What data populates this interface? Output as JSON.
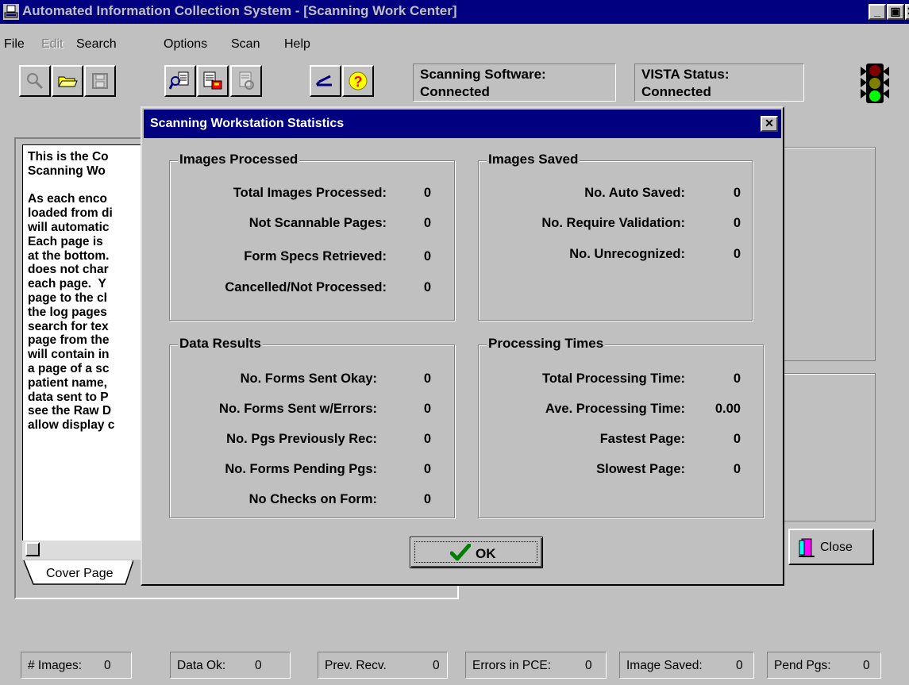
{
  "window": {
    "title": "Automated Information Collection System - [Scanning Work Center]",
    "min_glyph": "_",
    "restore_glyph": "▣",
    "close_glyph": "✕"
  },
  "menu": [
    {
      "label": "File",
      "disabled": false
    },
    {
      "label": "Edit",
      "disabled": true
    },
    {
      "label": "Search",
      "disabled": false
    },
    {
      "label": "Options",
      "disabled": false
    },
    {
      "label": "Scan",
      "disabled": false
    },
    {
      "label": "Help",
      "disabled": false
    }
  ],
  "toolbar": {
    "buttons": [
      "search-icon",
      "open-folder-icon",
      "save-disk-icon",
      "scan-document-icon",
      "edit-document-icon",
      "document-disabled-icon",
      "scanner-icon",
      "help-icon"
    ]
  },
  "status": {
    "scanning_label": "Scanning Software:",
    "scanning_value": "Connected",
    "vista_label": "VISTA Status:",
    "vista_value": "Connected",
    "traffic_light": "traffic-light-icon",
    "colors": {
      "red": "#800000",
      "yellow": "#808000",
      "green": "#00ff00"
    }
  },
  "cover": {
    "text": "This is the Co\nScanning Wo\n\nAs each enco\nloaded from di\nwill automatic\nEach page is\nat the bottom.\ndoes not char\neach page.  Y\npage to the cl\nthe log pages\nsearch for tex\npage from the\nwill contain in\na page of a sc\npatient name,\ndata sent to P\nsee the Raw D\nallow display c",
    "tab": "Cover Page"
  },
  "dialog": {
    "title": "Scanning Workstation Statistics",
    "images_processed": {
      "title": "Images Processed",
      "rows": [
        {
          "label": "Total Images Processed:",
          "value": "0"
        },
        {
          "label": "Not Scannable Pages:",
          "value": "0"
        },
        {
          "label": "Form Specs Retrieved:",
          "value": "0"
        },
        {
          "label": "Cancelled/Not Processed:",
          "value": "0"
        }
      ]
    },
    "images_saved": {
      "title": "Images Saved",
      "rows": [
        {
          "label": "No. Auto Saved:",
          "value": "0"
        },
        {
          "label": "No. Require Validation:",
          "value": "0"
        },
        {
          "label": "No. Unrecognized:",
          "value": "0"
        }
      ]
    },
    "data_results": {
      "title": "Data Results",
      "rows": [
        {
          "label": "No. Forms Sent Okay:",
          "value": "0"
        },
        {
          "label": "No. Forms Sent w/Errors:",
          "value": "0"
        },
        {
          "label": "No. Pgs Previously Rec:",
          "value": "0"
        },
        {
          "label": "No. Forms Pending Pgs:",
          "value": "0"
        },
        {
          "label": "No Checks on Form:",
          "value": "0"
        }
      ]
    },
    "processing_times": {
      "title": "Processing Times",
      "rows": [
        {
          "label": "Total Processing Time:",
          "value": "0"
        },
        {
          "label": "Ave. Processing Time:",
          "value": "0.00"
        },
        {
          "label": "Fastest Page:",
          "value": "0"
        },
        {
          "label": "Slowest Page:",
          "value": "0"
        }
      ]
    },
    "ok_label": "OK"
  },
  "close_button": {
    "label": "Close"
  },
  "statusbar": [
    {
      "label": "# Images:",
      "value": "0"
    },
    {
      "label": "Data Ok:",
      "value": "0"
    },
    {
      "label": "Prev. Recv.",
      "value": "0"
    },
    {
      "label": "Errors in PCE:",
      "value": "0"
    },
    {
      "label": "Image Saved:",
      "value": "0"
    },
    {
      "label": "Pend Pgs:",
      "value": "0"
    }
  ]
}
